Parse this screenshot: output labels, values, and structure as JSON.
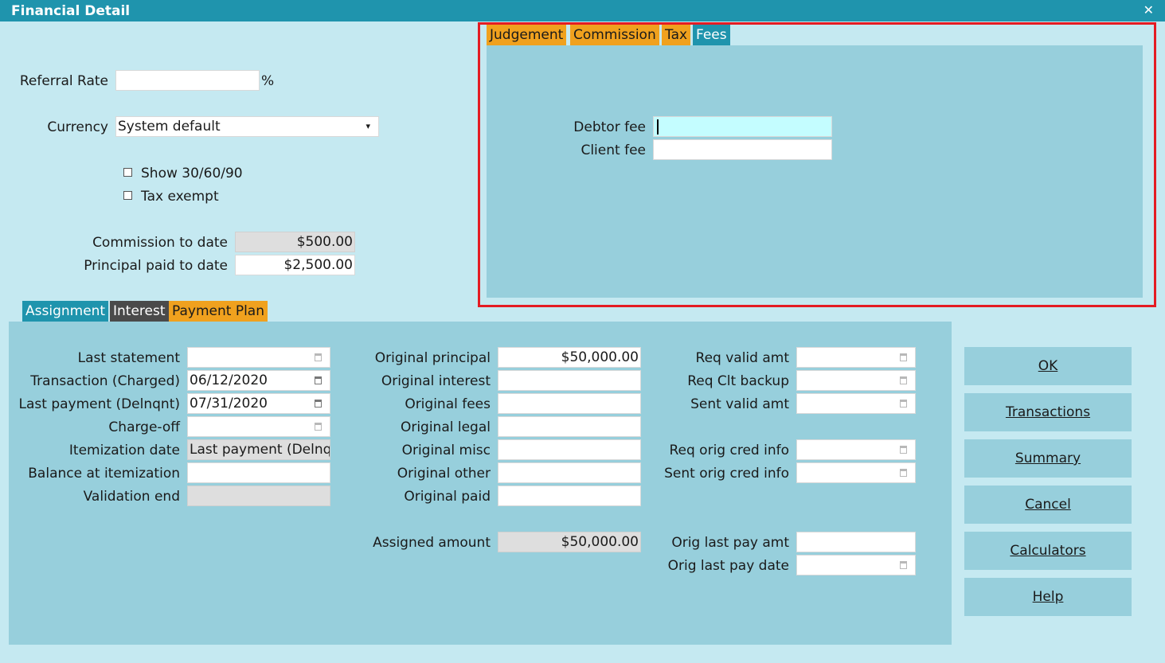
{
  "window": {
    "title": "Financial Detail",
    "close_glyph": "✕"
  },
  "top_left": {
    "referral_rate_label": "Referral Rate",
    "referral_rate_value": "",
    "referral_rate_unit": "%",
    "currency_label": "Currency",
    "currency_value": "System default",
    "show_30_60_90_label": "Show 30/60/90",
    "show_30_60_90_checked": false,
    "tax_exempt_label": "Tax exempt",
    "tax_exempt_checked": false,
    "commission_to_date_label": "Commission to date",
    "commission_to_date_value": "$500.00",
    "principal_paid_label": "Principal paid to date",
    "principal_paid_value": "$2,500.00"
  },
  "fees_panel": {
    "tabs": [
      "Judgement",
      "Commission",
      "Tax",
      "Fees"
    ],
    "active_tab": "Fees",
    "debtor_fee_label": "Debtor fee",
    "debtor_fee_value": "",
    "client_fee_label": "Client fee",
    "client_fee_value": "",
    "highlight_color": "#e41c23"
  },
  "bottom_tabs": {
    "tabs": [
      "Assignment",
      "Interest",
      "Payment Plan"
    ],
    "active_tab": "Assignment"
  },
  "assignment": {
    "col1": [
      {
        "label": "Last statement",
        "value": "",
        "type": "date"
      },
      {
        "label": "Transaction (Charged)",
        "value": "06/12/2020",
        "type": "date"
      },
      {
        "label": "Last payment (Delnqnt)",
        "value": "07/31/2020",
        "type": "date"
      },
      {
        "label": "Charge-off",
        "value": "",
        "type": "date"
      },
      {
        "label": "Itemization date",
        "value": "Last payment (Delnqnt)",
        "type": "readonly"
      },
      {
        "label": "Balance at itemization",
        "value": "",
        "type": "text"
      },
      {
        "label": "Validation end",
        "value": "",
        "type": "readonly"
      }
    ],
    "col2": [
      {
        "label": "Original principal",
        "value": "$50,000.00"
      },
      {
        "label": "Original interest",
        "value": ""
      },
      {
        "label": "Original fees",
        "value": ""
      },
      {
        "label": "Original legal",
        "value": ""
      },
      {
        "label": "Original misc",
        "value": ""
      },
      {
        "label": "Original other",
        "value": ""
      },
      {
        "label": "Original paid",
        "value": ""
      }
    ],
    "assigned_amount_label": "Assigned amount",
    "assigned_amount_value": "$50,000.00",
    "col3": [
      {
        "label": "Req valid amt",
        "value": "",
        "type": "date"
      },
      {
        "label": "Req Clt backup",
        "value": "",
        "type": "date"
      },
      {
        "label": "Sent valid amt",
        "value": "",
        "type": "date"
      },
      {
        "label": "Req orig cred info",
        "value": "",
        "type": "date"
      },
      {
        "label": "Sent orig cred info",
        "value": "",
        "type": "date"
      },
      {
        "label": "Orig last pay amt",
        "value": "",
        "type": "text"
      },
      {
        "label": "Orig last pay date",
        "value": "",
        "type": "date"
      }
    ]
  },
  "buttons": {
    "ok": "OK",
    "transactions": "Transactions",
    "summary": "Summary",
    "cancel": "Cancel",
    "calculators": "Calculators",
    "help": "Help"
  },
  "colors": {
    "window_bg": "#c5e9f1",
    "title_bar": "#1f94ad",
    "panel": "#97cfdc",
    "tab_orange": "#f0a11e",
    "tab_teal": "#1f94ad",
    "tab_dark": "#4a4a4a"
  }
}
